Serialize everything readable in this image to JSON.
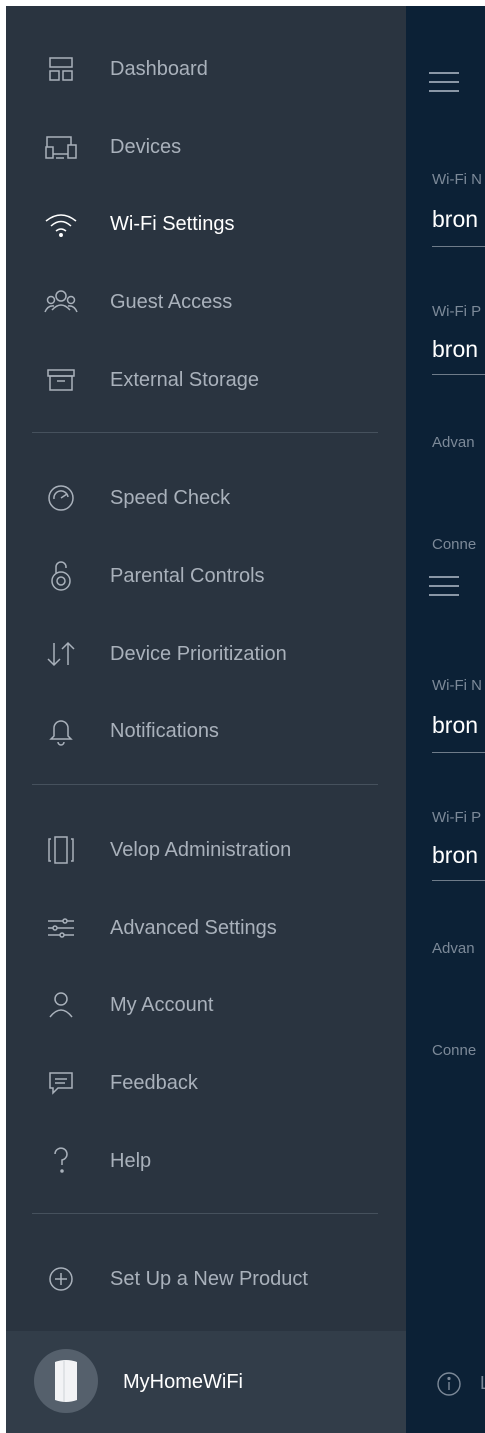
{
  "sidebar": {
    "items": [
      {
        "label": "Dashboard",
        "icon": "dashboard-icon"
      },
      {
        "label": "Devices",
        "icon": "devices-icon"
      },
      {
        "label": "Wi-Fi Settings",
        "icon": "wifi-icon",
        "active": true
      },
      {
        "label": "Guest Access",
        "icon": "guest-access-icon"
      },
      {
        "label": "External Storage",
        "icon": "external-storage-icon"
      },
      {
        "label": "Speed Check",
        "icon": "speed-check-icon"
      },
      {
        "label": "Parental Controls",
        "icon": "parental-controls-icon"
      },
      {
        "label": "Device Prioritization",
        "icon": "device-prioritization-icon"
      },
      {
        "label": "Notifications",
        "icon": "bell-icon"
      },
      {
        "label": "Velop Administration",
        "icon": "velop-node-icon"
      },
      {
        "label": "Advanced Settings",
        "icon": "sliders-icon"
      },
      {
        "label": "My Account",
        "icon": "user-icon"
      },
      {
        "label": "Feedback",
        "icon": "feedback-icon"
      },
      {
        "label": "Help",
        "icon": "help-icon"
      },
      {
        "label": "Set Up a New Product",
        "icon": "add-circle-icon"
      }
    ],
    "network_name": "MyHomeWiFi"
  },
  "panel": {
    "blocks": [
      {
        "wifi_name_label": "Wi-Fi N",
        "wifi_name_value": "bron",
        "wifi_pw_label": "Wi-Fi P",
        "wifi_pw_value": "bron",
        "advanced_label": "Advan",
        "connected_label": "Conne"
      },
      {
        "wifi_name_label": "Wi-Fi N",
        "wifi_name_value": "bron",
        "wifi_pw_label": "Wi-Fi P",
        "wifi_pw_value": "bron",
        "advanced_label": "Advan",
        "connected_label": "Conne"
      }
    ],
    "info_text": "L"
  },
  "colors": {
    "sidebar_bg": "#2a3440",
    "panel_bg": "#0c2136",
    "label_inactive": "#a9b1bb",
    "label_active": "#ffffff"
  }
}
